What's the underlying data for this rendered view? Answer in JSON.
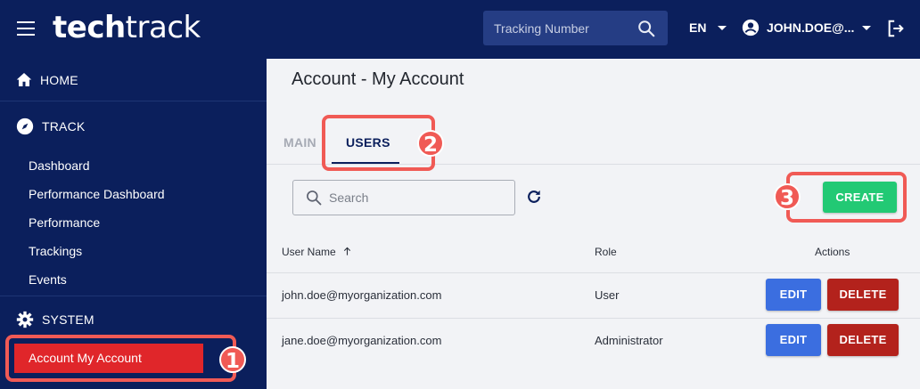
{
  "header": {
    "logo_bold": "tech",
    "logo_light": "track",
    "tracking_placeholder": "Tracking Number",
    "language": "EN",
    "user": "JOHN.DOE@..."
  },
  "sidebar": {
    "home": "HOME",
    "track": "TRACK",
    "track_items": [
      "Dashboard",
      "Performance Dashboard",
      "Performance",
      "Trackings",
      "Events"
    ],
    "system": "SYSTEM",
    "active_item": "Account My Account"
  },
  "page": {
    "title": "Account - My Account",
    "tabs": [
      {
        "label": "MAIN"
      },
      {
        "label": "USERS",
        "active": true
      }
    ],
    "search_placeholder": "Search",
    "create_label": "CREATE"
  },
  "table": {
    "headers": {
      "user_name": "User Name",
      "role": "Role",
      "actions": "Actions"
    },
    "sort_icon": "arrow-up-icon",
    "rows": [
      {
        "user": "john.doe@myorganization.com",
        "role": "User",
        "edit": "EDIT",
        "delete": "DELETE"
      },
      {
        "user": "jane.doe@myorganization.com",
        "role": "Administrator",
        "edit": "EDIT",
        "delete": "DELETE"
      }
    ]
  },
  "annotations": [
    "1",
    "2",
    "3"
  ],
  "colors": {
    "navy": "#0b1f5c",
    "accent_red": "#e0262a",
    "annotation": "#f05a55",
    "create_green": "#22c974",
    "edit_blue": "#3b6ee0",
    "delete_red": "#b3221c"
  }
}
